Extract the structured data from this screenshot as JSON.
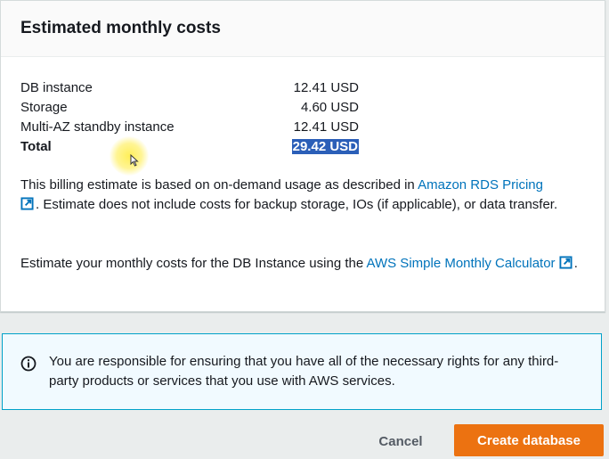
{
  "card": {
    "title": "Estimated monthly costs",
    "rows": [
      {
        "label": "DB instance",
        "value": "12.41 USD"
      },
      {
        "label": "Storage",
        "value": "4.60 USD"
      },
      {
        "label": "Multi-AZ standby instance",
        "value": "12.41 USD"
      }
    ],
    "total": {
      "label": "Total",
      "value": "29.42 USD"
    },
    "billing": {
      "text_before": "This billing estimate is based on on-demand usage as described in ",
      "link": "Amazon RDS Pricing",
      "text_after": ". Estimate does not include costs for backup storage, IOs (if applicable), or data transfer."
    },
    "calculator": {
      "text_before": "Estimate your monthly costs for the DB Instance using the ",
      "link": "AWS Simple Monthly Calculator",
      "text_after": "."
    }
  },
  "info": {
    "text": "You are responsible for ensuring that you have all of the necessary rights for any third-party products or services that you use with AWS services."
  },
  "actions": {
    "cancel": "Cancel",
    "create": "Create database"
  },
  "colors": {
    "primary_button": "#ec7211",
    "link": "#0073bb",
    "info_border": "#00a1c9",
    "info_background": "#f1faff",
    "selection": "#2b5fb8"
  },
  "icons": {
    "external_link": "external-link-icon",
    "info": "info-icon",
    "cursor": "mouse-cursor-icon"
  }
}
